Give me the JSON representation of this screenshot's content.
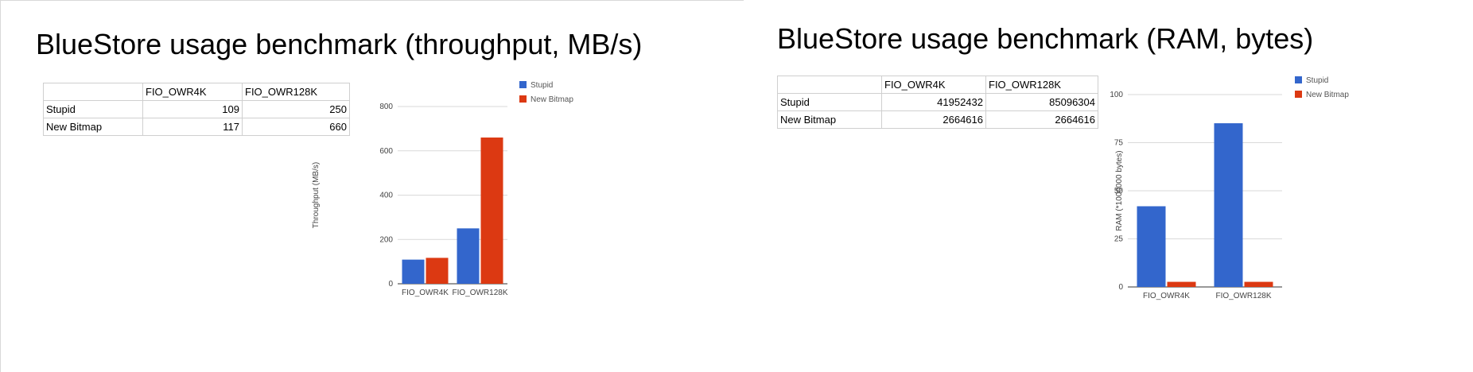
{
  "left": {
    "title": "BlueStore usage benchmark (throughput, MB/s)",
    "table": {
      "headers": [
        "",
        "FIO_OWR4K",
        "FIO_OWR128K"
      ],
      "rows": [
        [
          "Stupid",
          "109",
          "250"
        ],
        [
          "New Bitmap",
          "117",
          "660"
        ]
      ]
    }
  },
  "right": {
    "title": "BlueStore usage benchmark (RAM, bytes)",
    "table": {
      "headers": [
        "",
        "FIO_OWR4K",
        "FIO_OWR128K"
      ],
      "rows": [
        [
          "Stupid",
          "41952432",
          "85096304"
        ],
        [
          "New Bitmap",
          "2664616",
          "2664616"
        ]
      ]
    }
  },
  "chart_data": [
    {
      "type": "bar",
      "title": "",
      "xlabel": "",
      "ylabel": "Throughput (MB/s)",
      "categories": [
        "FIO_OWR4K",
        "FIO_OWR128K"
      ],
      "series": [
        {
          "name": "Stupid",
          "values": [
            109,
            250
          ],
          "color": "#3366cc"
        },
        {
          "name": "New Bitmap",
          "values": [
            117,
            660
          ],
          "color": "#dc3912"
        }
      ],
      "ylim": [
        0,
        800
      ],
      "yticks": [
        0,
        200,
        400,
        600,
        800
      ],
      "grid": true,
      "legend": "right"
    },
    {
      "type": "bar",
      "title": "",
      "xlabel": "",
      "ylabel": "RAM (*1000000 bytes)",
      "categories": [
        "FIO_OWR4K",
        "FIO_OWR128K"
      ],
      "series": [
        {
          "name": "Stupid",
          "values": [
            41.95,
            85.1
          ],
          "color": "#3366cc"
        },
        {
          "name": "New Bitmap",
          "values": [
            2.66,
            2.66
          ],
          "color": "#dc3912"
        }
      ],
      "ylim": [
        0,
        100
      ],
      "yticks": [
        0,
        25,
        50,
        75,
        100
      ],
      "grid": true,
      "legend": "right"
    }
  ]
}
